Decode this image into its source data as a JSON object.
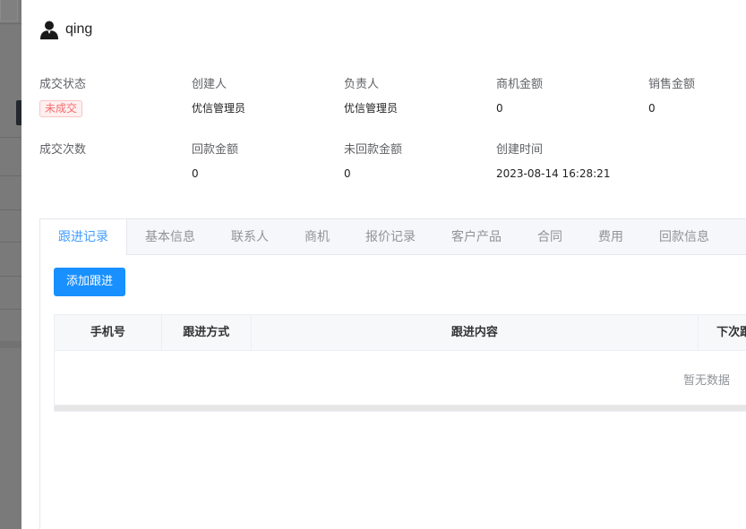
{
  "customer": {
    "name": "qing"
  },
  "info": [
    {
      "label": "成交状态",
      "value": "未成交",
      "type": "tag"
    },
    {
      "label": "创建人",
      "value": "优信管理员"
    },
    {
      "label": "负责人",
      "value": "优信管理员"
    },
    {
      "label": "商机金额",
      "value": "0"
    },
    {
      "label": "销售金额",
      "value": "0"
    },
    {
      "label": "成交次数",
      "value": ""
    },
    {
      "label": "回款金额",
      "value": "0"
    },
    {
      "label": "未回款金额",
      "value": "0"
    },
    {
      "label": "创建时间",
      "value": "2023-08-14 16:28:21"
    }
  ],
  "tabs": [
    {
      "label": "跟进记录",
      "active": true
    },
    {
      "label": "基本信息"
    },
    {
      "label": "联系人"
    },
    {
      "label": "商机"
    },
    {
      "label": "报价记录"
    },
    {
      "label": "客户产品"
    },
    {
      "label": "合同"
    },
    {
      "label": "费用"
    },
    {
      "label": "回款信息"
    }
  ],
  "actions": {
    "add_followup": "添加跟进"
  },
  "table": {
    "columns": [
      "手机号",
      "跟进方式",
      "跟进内容",
      "下次跟"
    ],
    "empty_text": "暂无数据"
  },
  "colors": {
    "accent": "#409eff",
    "primary_button": "#1890ff",
    "tag_red": "#f56c6c"
  }
}
